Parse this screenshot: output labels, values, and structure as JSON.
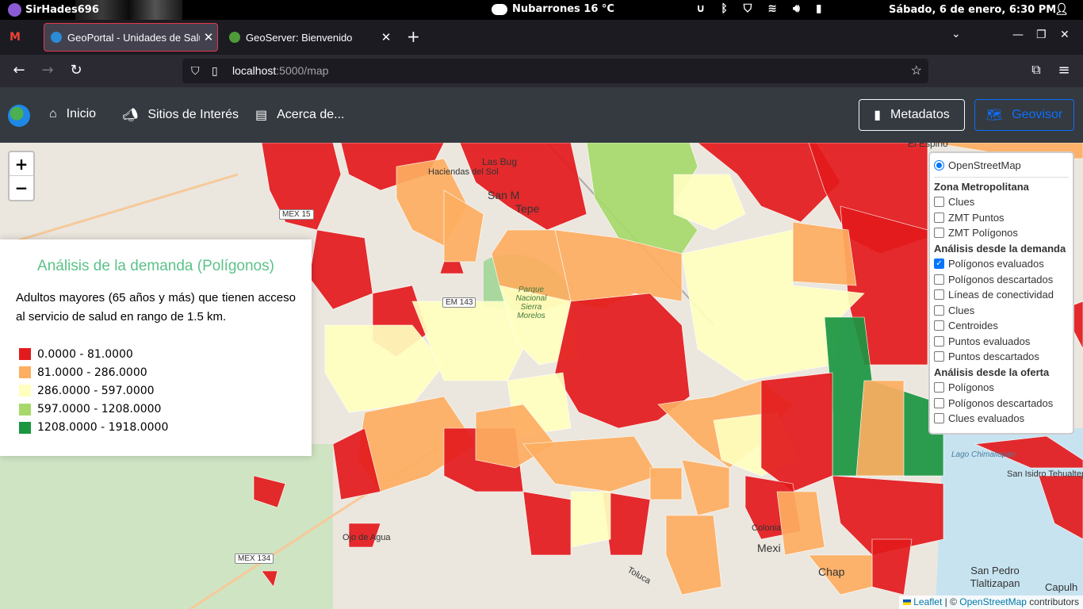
{
  "os": {
    "username": "SirHades696",
    "weather": "Nubarrones 16 °C",
    "clock": "Sábado,  6 de enero,  6:30 PM"
  },
  "browser": {
    "tabs": [
      {
        "title": "GeoPortal - Unidades de Salud",
        "active": true
      },
      {
        "title": "GeoServer: Bienvenido",
        "active": false
      }
    ],
    "url_host": "localhost",
    "url_path": ":5000/map"
  },
  "app": {
    "nav": {
      "home": "Inicio",
      "sites": "Sitios de Interés",
      "about": "Acerca de..."
    },
    "buttons": {
      "metadata": "Metadatos",
      "viewer": "Geovisor"
    }
  },
  "map": {
    "zoom_in": "+",
    "zoom_out": "−",
    "labels": {
      "san_miguel": "San M",
      "tepe": "Tepe",
      "las_bugambilias": "Las Bug",
      "haciendas_del_sol": "Haciendas del Sol",
      "parque": "Parque Nacional Sierra Morelos",
      "el_espino": "El Espino",
      "lago": "Lago Chimaliapan",
      "san_isidro": "San Isidro Tehualtepec",
      "mexicaltzingo": "Mexi",
      "chapultepec": "Chap",
      "san_pedro": "San Pedro Tlaltizapan",
      "capulhuac": "Capulh",
      "ojo_de_agua": "Ojo de Agua",
      "colonia": "Colonia",
      "toluca": "Toluca"
    },
    "shields": {
      "mex15": "MEX 15",
      "em143": "EM 143",
      "mex134": "MEX 134"
    }
  },
  "legend": {
    "title": "Análisis de la demanda (Polígonos)",
    "description": "Adultos mayores (65 años y más) que tienen acceso al servicio de salud en rango de 1.5 km.",
    "classes": [
      {
        "label": "0.0000 - 81.0000",
        "color": "#e31a1c"
      },
      {
        "label": "81.0000 - 286.0000",
        "color": "#fdae61"
      },
      {
        "label": "286.0000 - 597.0000",
        "color": "#ffffbf"
      },
      {
        "label": "597.0000 - 1208.0000",
        "color": "#a6d96a"
      },
      {
        "label": "1208.0000 - 1918.0000",
        "color": "#1a9641"
      }
    ]
  },
  "layers": {
    "base": "OpenStreetMap",
    "groups": [
      {
        "title": "Zona Metropolitana",
        "items": [
          {
            "label": "Clues",
            "checked": false
          },
          {
            "label": "ZMT Puntos",
            "checked": false
          },
          {
            "label": "ZMT Polígonos",
            "checked": false
          }
        ]
      },
      {
        "title": "Análisis desde la demanda",
        "items": [
          {
            "label": "Polígonos evaluados",
            "checked": true
          },
          {
            "label": "Polígonos descartados",
            "checked": false
          },
          {
            "label": "Líneas de conectividad",
            "checked": false
          },
          {
            "label": "Clues",
            "checked": false
          },
          {
            "label": "Centroides",
            "checked": false
          },
          {
            "label": "Puntos evaluados",
            "checked": false
          },
          {
            "label": "Puntos descartados",
            "checked": false
          }
        ]
      },
      {
        "title": "Análisis desde la oferta",
        "items": [
          {
            "label": "Polígonos",
            "checked": false
          },
          {
            "label": "Polígonos descartados",
            "checked": false
          },
          {
            "label": "Clues evaluados",
            "checked": false
          }
        ]
      }
    ]
  },
  "attribution": {
    "leaflet": "Leaflet",
    "sep": " | © ",
    "osm": "OpenStreetMap",
    "rest": " contributors"
  }
}
